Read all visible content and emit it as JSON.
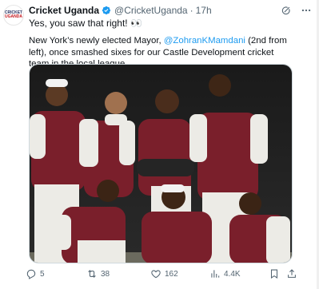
{
  "tweet": {
    "author_name": "Cricket Uganda",
    "handle": "@CricketUganda",
    "separator": "·",
    "time": "17h",
    "line1": "Yes, you saw that right! 👀",
    "body_before": "New York’s newly elected Mayor, ",
    "mention": "@ZohranKMamdani",
    "body_after": " (2nd from left), once smashed sixes for our Castle Development cricket team in the local league.",
    "avatar_logo_top": "CRICKET",
    "avatar_logo_bottom": "UGANDA"
  },
  "metrics": {
    "replies": "5",
    "reposts": "38",
    "likes": "162",
    "views": "4.4K"
  },
  "colors": {
    "link": "#1d9bf0",
    "verified": "#1d9bf0",
    "secondary_text": "#536471",
    "jersey_maroon": "#7a1f2b"
  },
  "icons": [
    "grok-icon",
    "more-icon",
    "verified-badge-icon",
    "reply-icon",
    "repost-icon",
    "like-icon",
    "views-icon",
    "bookmark-icon",
    "share-icon"
  ]
}
